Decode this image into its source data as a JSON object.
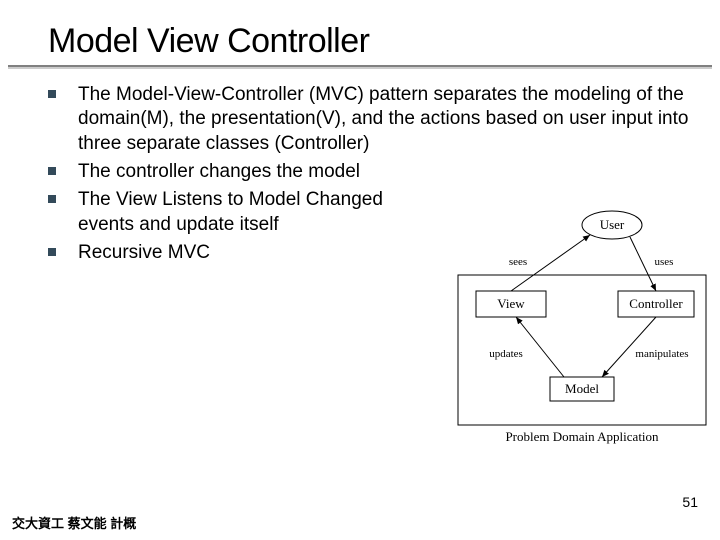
{
  "title": "Model View Controller",
  "bullets": [
    "The Model-View-Controller (MVC) pattern separates the modeling of the domain(M), the presentation(V), and the actions based on user input into three separate classes (Controller)",
    "The controller changes the model",
    "The View Listens to Model Changed events and update itself",
    "Recursive MVC"
  ],
  "diagram": {
    "user_label": "User",
    "view_label": "View",
    "controller_label": "Controller",
    "model_label": "Model",
    "caption": "Problem Domain Application",
    "edge_sees": "sees",
    "edge_uses": "uses",
    "edge_updates": "updates",
    "edge_manipulates": "manipulates"
  },
  "footer": "交大資工 蔡文能 計概",
  "page_number": "51"
}
